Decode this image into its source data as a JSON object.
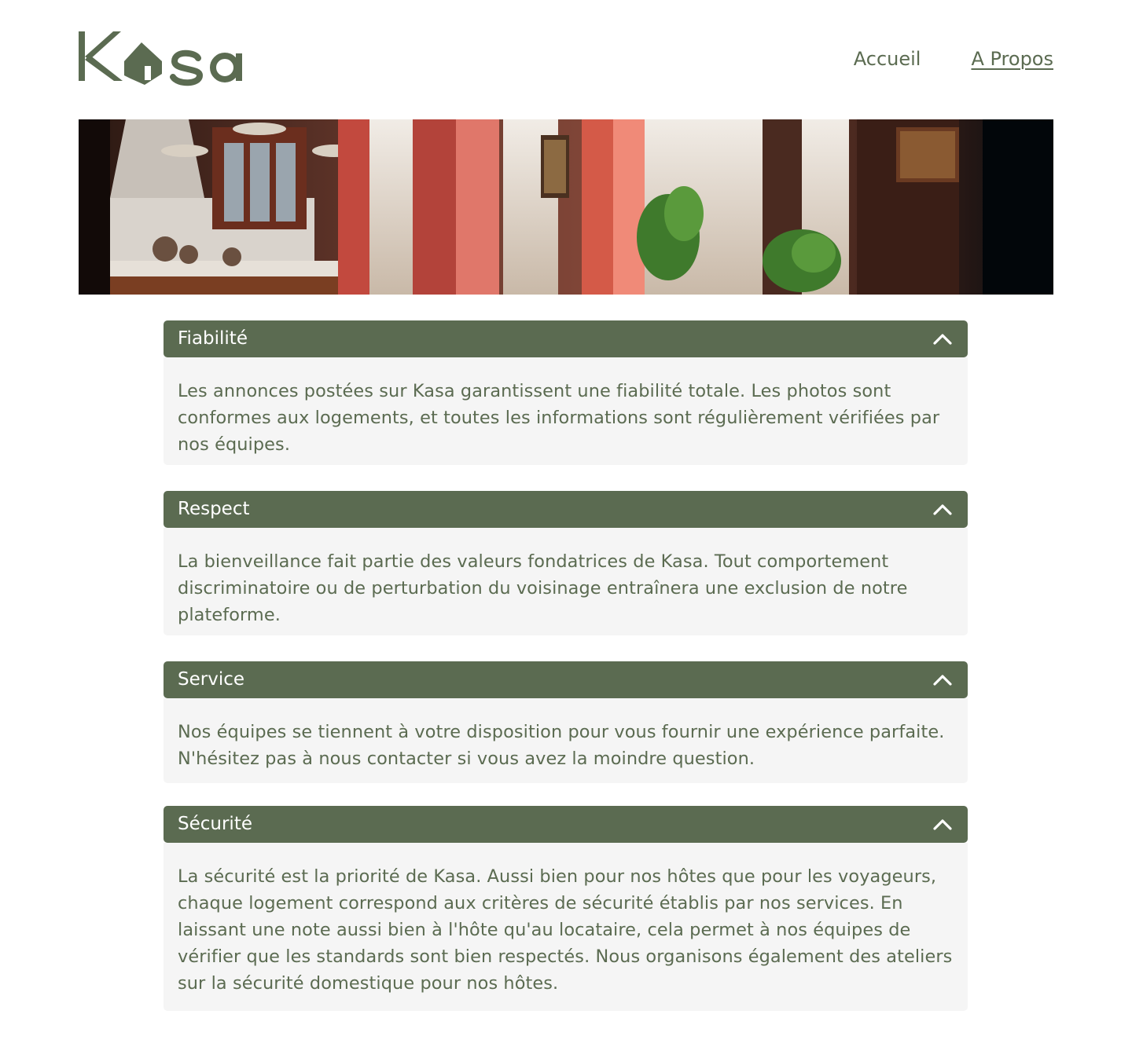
{
  "brand": {
    "name": "Kasa",
    "color": "#5b6b51"
  },
  "nav": {
    "items": [
      {
        "label": "Accueil",
        "active": false
      },
      {
        "label": "A Propos",
        "active": true
      }
    ]
  },
  "banner": {
    "description": "interior-room-banner"
  },
  "accordions": [
    {
      "title": "Fiabilité",
      "icon": "chevron-up-icon",
      "expanded": true,
      "text": "Les annonces postées sur Kasa garantissent une fiabilité totale. Les photos sont conformes aux logements, et toutes les informations sont régulièrement vérifiées par nos équipes."
    },
    {
      "title": "Respect",
      "icon": "chevron-up-icon",
      "expanded": true,
      "text": "La bienveillance fait partie des valeurs fondatrices de Kasa. Tout comportement discriminatoire ou de perturbation du voisinage entraînera une exclusion de notre plateforme."
    },
    {
      "title": "Service",
      "icon": "chevron-up-icon",
      "expanded": true,
      "text": "Nos équipes se tiennent à votre disposition pour vous fournir une expérience parfaite. N'hésitez pas à nous contacter si vous avez la moindre question."
    },
    {
      "title": "Sécurité",
      "icon": "chevron-up-icon",
      "expanded": true,
      "text": "La sécurité est la priorité de Kasa. Aussi bien pour nos hôtes que pour les voyageurs, chaque logement correspond aux critères de sécurité établis par nos services. En laissant une note aussi bien à l'hôte qu'au locataire, cela permet à nos équipes de vérifier que les standards sont bien respectés. Nous organisons également des ateliers sur la sécurité domestique pour nos hôtes."
    }
  ]
}
